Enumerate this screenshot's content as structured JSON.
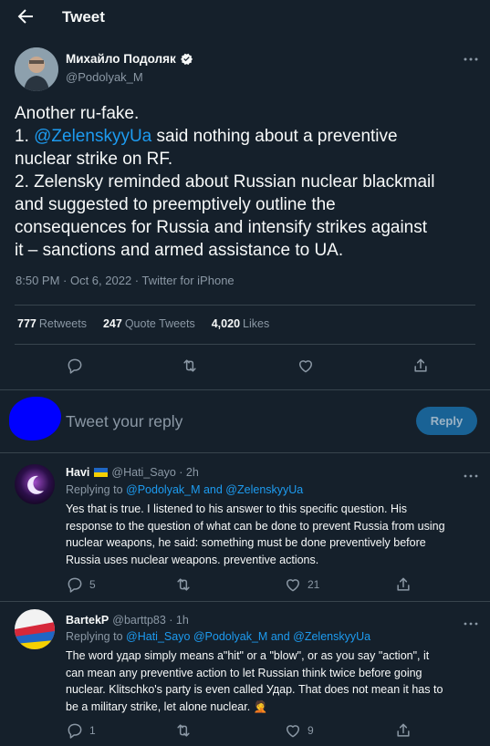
{
  "header": {
    "title": "Tweet"
  },
  "tweet": {
    "author_name": "Михайло Подоляк",
    "author_handle": "@Podolyak_M",
    "text_line1": "Another ru-fake.",
    "text_line2_prefix": "1. ",
    "text_line2_mention": "@ZelenskyyUa",
    "text_line2_suffix": " said nothing about a preventive",
    "text_line3": "nuclear strike on RF.",
    "text_line4": "2. Zelensky reminded about Russian nuclear blackmail",
    "text_line5": "and suggested to preemptively outline the",
    "text_line6": "consequences for Russia and intensify strikes against",
    "text_line7": "it – sanctions and armed assistance to UA.",
    "meta": "8:50 PM · Oct 6, 2022 · Twitter for iPhone",
    "retweets_count": "777",
    "retweets_label": "Retweets",
    "quotes_count": "247",
    "quotes_label": "Quote Tweets",
    "likes_count": "4,020",
    "likes_label": "Likes"
  },
  "composer": {
    "placeholder": "Tweet your reply",
    "button_label": "Reply"
  },
  "replies": [
    {
      "name": "Havi",
      "meta": "@Hati_Sayo · 2h",
      "replying_prefix": "Replying to",
      "replying_mentions": "@Podolyak_M and @ZelenskyyUa",
      "lines": [
        "Yes that is true. I listened to his answer to this specific question. His",
        "response to the question of what can be done to prevent Russia from using",
        "nuclear weapons, he said: something must be done preventively before",
        "Russia uses nuclear weapons. preventive actions."
      ],
      "reply_count": "5",
      "like_count": "21"
    },
    {
      "name": "BartekP",
      "meta": "@barttp83 · 1h",
      "replying_prefix": "Replying to",
      "replying_mentions": "@Hati_Sayo @Podolyak_M and @ZelenskyyUa",
      "lines": [
        "The word удар simply means a\"hit\" or a \"blow\", or as you say \"action\", it",
        "can mean any preventive action to let Russian think twice before going",
        "nuclear. Klitschko's party is even called Удар. That does not mean it has to",
        "be a military strike, let alone nuclear. 🤦"
      ],
      "reply_count": "1",
      "like_count": "9"
    }
  ],
  "icons": {
    "back": "arrow-left-icon",
    "verified": "verified-badge-icon",
    "more": "more-icon",
    "reply": "reply-icon",
    "retweet": "retweet-icon",
    "like": "heart-icon",
    "share": "share-icon"
  },
  "colors": {
    "background": "#15202b",
    "accent": "#1d9bf0",
    "secondary_text": "#8b98a5",
    "divider": "#38444d"
  }
}
